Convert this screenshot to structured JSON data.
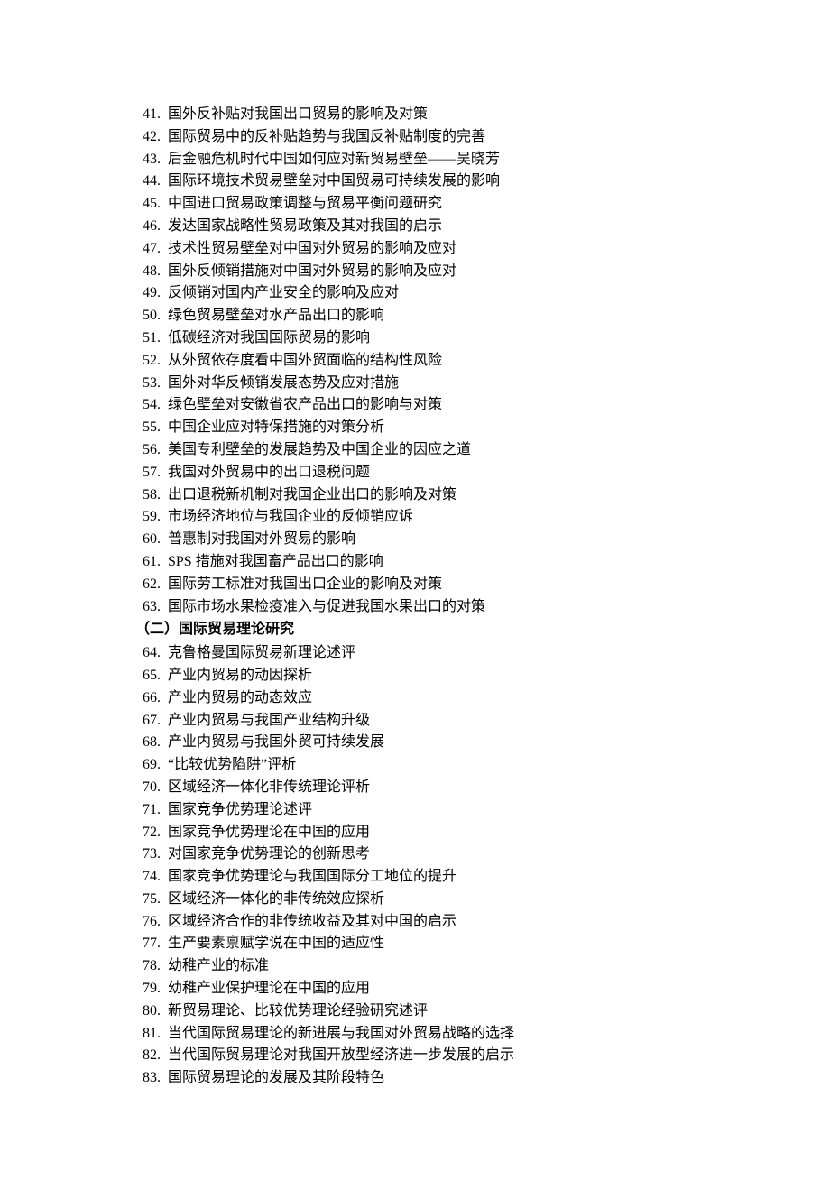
{
  "items_section_a": [
    {
      "num": "41",
      "text": "国外反补贴对我国出口贸易的影响及对策"
    },
    {
      "num": "42",
      "text": "国际贸易中的反补贴趋势与我国反补贴制度的完善"
    },
    {
      "num": "43",
      "text": "后金融危机时代中国如何应对新贸易壁垒——吴晓芳"
    },
    {
      "num": "44",
      "text": "国际环境技术贸易壁垒对中国贸易可持续发展的影响"
    },
    {
      "num": "45",
      "text": "中国进口贸易政策调整与贸易平衡问题研究"
    },
    {
      "num": "46",
      "text": "发达国家战略性贸易政策及其对我国的启示"
    },
    {
      "num": "47",
      "text": "技术性贸易壁垒对中国对外贸易的影响及应对"
    },
    {
      "num": "48",
      "text": "国外反倾销措施对中国对外贸易的影响及应对"
    },
    {
      "num": "49",
      "text": "反倾销对国内产业安全的影响及应对"
    },
    {
      "num": "50",
      "text": "绿色贸易壁垒对水产品出口的影响"
    },
    {
      "num": "51",
      "text": "低碳经济对我国国际贸易的影响"
    },
    {
      "num": "52",
      "text": "从外贸依存度看中国外贸面临的结构性风险"
    },
    {
      "num": "53",
      "text": "国外对华反倾销发展态势及应对措施"
    },
    {
      "num": "54",
      "text": "绿色壁垒对安徽省农产品出口的影响与对策"
    },
    {
      "num": "55",
      "text": "中国企业应对特保措施的对策分析"
    },
    {
      "num": "56",
      "text": "美国专利壁垒的发展趋势及中国企业的因应之道"
    },
    {
      "num": "57",
      "text": "我国对外贸易中的出口退税问题"
    },
    {
      "num": "58",
      "text": "出口退税新机制对我国企业出口的影响及对策"
    },
    {
      "num": "59",
      "text": "市场经济地位与我国企业的反倾销应诉"
    },
    {
      "num": "60",
      "text": "普惠制对我国对外贸易的影响"
    },
    {
      "num": "61",
      "text": "SPS 措施对我国畜产品出口的影响"
    },
    {
      "num": "62",
      "text": "国际劳工标准对我国出口企业的影响及对策"
    },
    {
      "num": "63",
      "text": "国际市场水果检疫准入与促进我国水果出口的对策"
    }
  ],
  "heading_b": "（二）国际贸易理论研究",
  "items_section_b": [
    {
      "num": "64",
      "text": "克鲁格曼国际贸易新理论述评"
    },
    {
      "num": "65",
      "text": "产业内贸易的动因探析"
    },
    {
      "num": "66",
      "text": "产业内贸易的动态效应"
    },
    {
      "num": "67",
      "text": "产业内贸易与我国产业结构升级"
    },
    {
      "num": "68",
      "text": "产业内贸易与我国外贸可持续发展"
    },
    {
      "num": "69",
      "text": "“比较优势陷阱”评析"
    },
    {
      "num": "70",
      "text": "区域经济一体化非传统理论评析"
    },
    {
      "num": "71",
      "text": "国家竞争优势理论述评"
    },
    {
      "num": "72",
      "text": "国家竞争优势理论在中国的应用"
    },
    {
      "num": "73",
      "text": "对国家竞争优势理论的创新思考"
    },
    {
      "num": "74",
      "text": "国家竞争优势理论与我国国际分工地位的提升"
    },
    {
      "num": "75",
      "text": "区域经济一体化的非传统效应探析"
    },
    {
      "num": "76",
      "text": "区域经济合作的非传统收益及其对中国的启示"
    },
    {
      "num": "77",
      "text": "生产要素禀赋学说在中国的适应性"
    },
    {
      "num": "78",
      "text": "幼稚产业的标准"
    },
    {
      "num": "79",
      "text": "幼稚产业保护理论在中国的应用"
    },
    {
      "num": "80",
      "text": "新贸易理论、比较优势理论经验研究述评"
    },
    {
      "num": "81",
      "text": "当代国际贸易理论的新进展与我国对外贸易战略的选择"
    },
    {
      "num": "82",
      "text": "当代国际贸易理论对我国开放型经济进一步发展的启示"
    },
    {
      "num": "83",
      "text": "国际贸易理论的发展及其阶段特色"
    }
  ]
}
